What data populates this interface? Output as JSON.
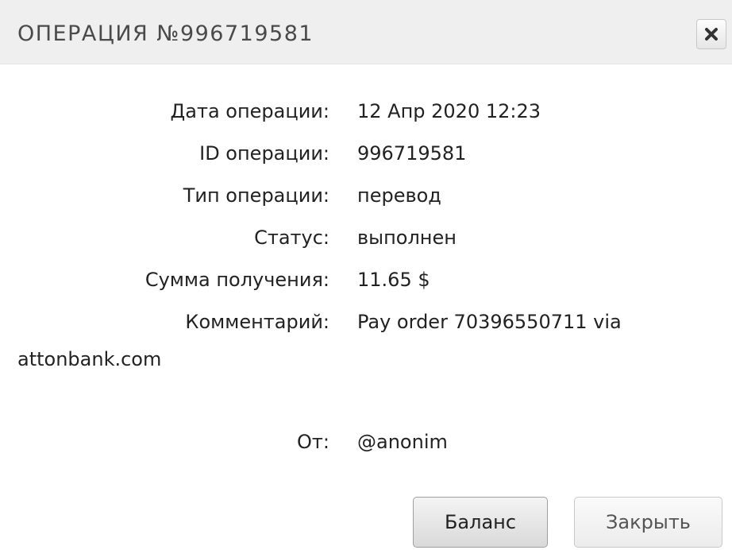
{
  "header": {
    "title": "ОПЕРАЦИЯ №996719581",
    "close_icon": "close-x-icon"
  },
  "details": {
    "rows": [
      {
        "label": "Дата операции:",
        "value": "12 Апр 2020 12:23"
      },
      {
        "label": "ID операции:",
        "value": "996719581"
      },
      {
        "label": "Тип операции:",
        "value": "перевод"
      },
      {
        "label": "Статус:",
        "value": "выполнен"
      },
      {
        "label": "Сумма получения:",
        "value": "11.65 $"
      },
      {
        "label": "Комментарий:",
        "value": "Pay order 70396550711 via"
      }
    ],
    "comment_continuation": "attonbank.com",
    "from": {
      "label": "От:",
      "value": "@anonim"
    }
  },
  "buttons": {
    "balance_label": "Баланс",
    "close_label": "Закрыть"
  }
}
